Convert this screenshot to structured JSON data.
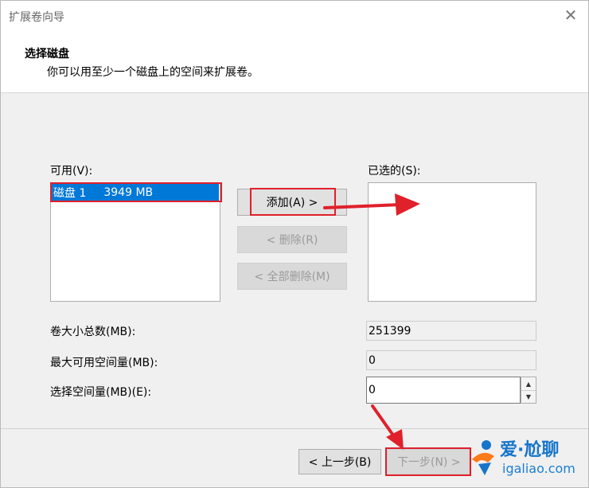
{
  "window": {
    "title": "扩展卷向导",
    "close_glyph": "✕"
  },
  "header": {
    "title": "选择磁盘",
    "subtitle": "你可以用至少一个磁盘上的空间来扩展卷。"
  },
  "available": {
    "label": "可用(V):",
    "items": [
      {
        "name": "磁盘 1",
        "size": "3949 MB",
        "selected": true
      }
    ]
  },
  "selected": {
    "label": "已选的(S):",
    "items": []
  },
  "buttons": {
    "add": "添加(A) >",
    "remove": "< 删除(R)",
    "remove_all": "< 全部删除(M)",
    "back": "< 上一步(B)",
    "next": "下一步(N) >"
  },
  "fields": {
    "total_label": "卷大小总数(MB):",
    "total_value": "251399",
    "max_label": "最大可用空间量(MB):",
    "max_value": "0",
    "select_label": "选择空间量(MB)(E):",
    "select_value": "0"
  },
  "watermark": {
    "title": "爱·尬聊",
    "url": "igaliao.com"
  },
  "colors": {
    "accent": "#0078d7",
    "annotation": "#e0202b",
    "watermark": "#1675c9"
  }
}
